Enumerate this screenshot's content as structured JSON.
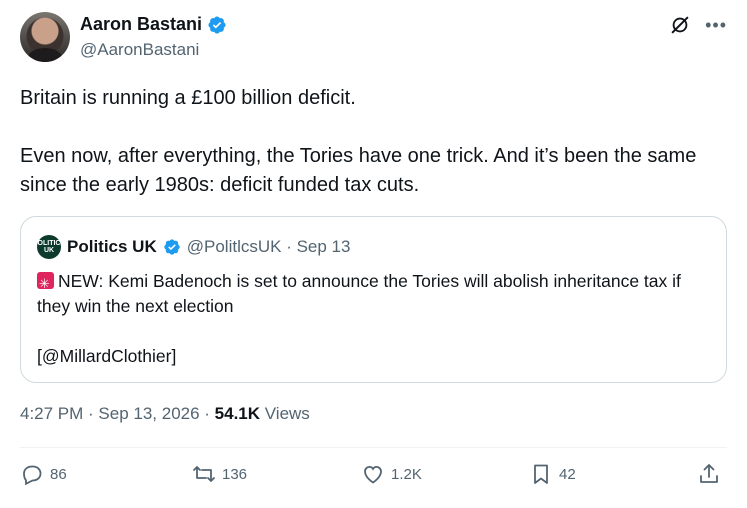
{
  "author": {
    "display_name": "Aaron Bastani",
    "handle": "@AaronBastani"
  },
  "tweet": {
    "line1": "Britain is running a £100 billion deficit.",
    "line2": "Even now, after everything, the Tories have one trick. And it’s been the same since the early 1980s: deficit funded tax cuts."
  },
  "quote": {
    "display_name": "Politics UK",
    "handle_date": "@PolitlcsUK · Sep 13",
    "avatar_text": "POLITICS UK",
    "line1": "NEW: Kemi Badenoch is set to announce the Tories will abolish inheritance tax if they win the next election",
    "line2": "[@MillardClothier]"
  },
  "meta": {
    "time_date": "4:27 PM · Sep 13, 2026 · ",
    "views_count": "54.1K",
    "views_label": " Views"
  },
  "actions": {
    "replies": "86",
    "reposts": "136",
    "likes": "1.2K",
    "bookmarks": "42"
  },
  "colors": {
    "verified": "#1d9bf0",
    "secondary_text": "#536471",
    "border": "#cfd9de"
  },
  "icons": [
    "verified-badge-icon",
    "grok-icon",
    "more-icon",
    "siren-emoji-icon",
    "reply-icon",
    "repost-icon",
    "like-icon",
    "bookmark-icon",
    "share-icon"
  ]
}
